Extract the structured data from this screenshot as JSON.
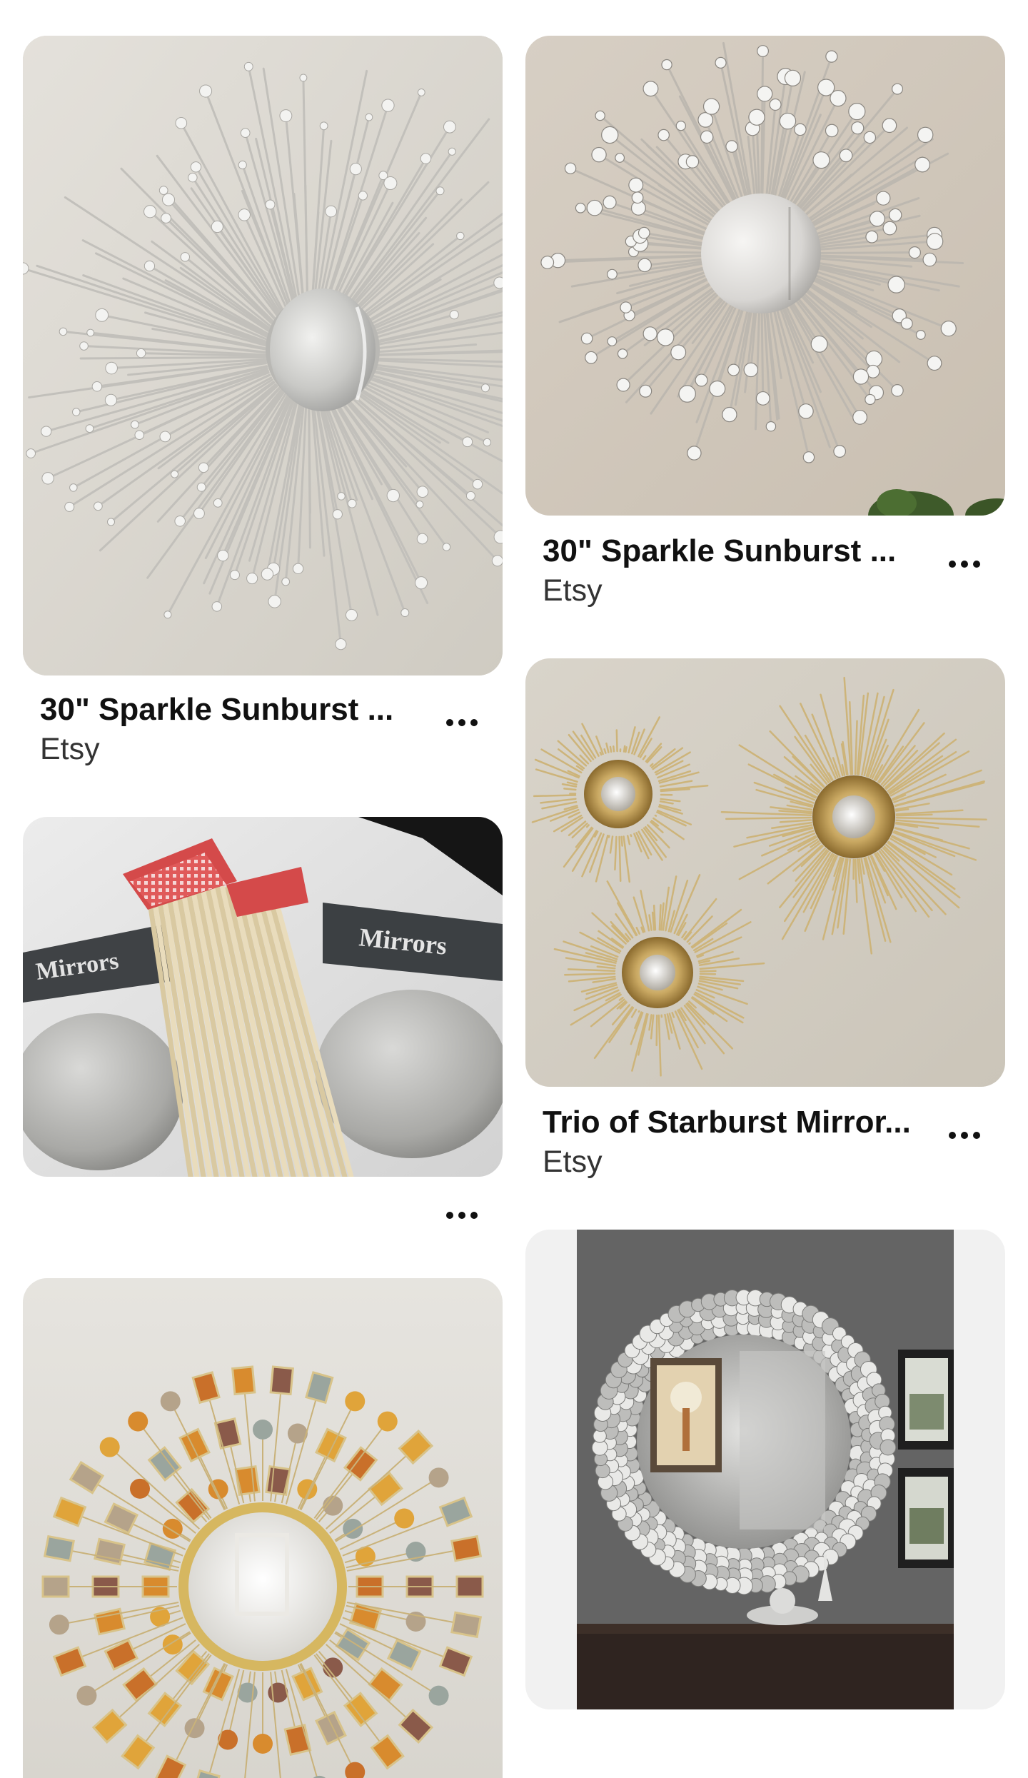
{
  "pins": [
    {
      "id": "pin-1",
      "title": "30\" Sparkle Sunburst ...",
      "source": "Etsy",
      "image_alt": "silver sunburst mirror with sparkle rods"
    },
    {
      "id": "pin-2",
      "title": "30\" Sparkle Sunburst ...",
      "source": "Etsy",
      "image_alt": "silver sunburst mirror with mirror dots"
    },
    {
      "id": "pin-3",
      "title": "Trio of Starburst Mirror...",
      "source": "Etsy",
      "image_alt": "three gold starburst mirrors"
    },
    {
      "id": "pin-4",
      "title": "",
      "source": "",
      "image_alt": "DIY supplies: round mirrors and wooden skewers"
    },
    {
      "id": "pin-5",
      "title": "",
      "source": "",
      "image_alt": "jeweled sunburst mirror with amber and stone tiles"
    },
    {
      "id": "pin-6",
      "title": "",
      "source": "",
      "image_alt": "round crystal mirror above a console table"
    }
  ],
  "supplies_package_label": "Mirrors",
  "icons": {
    "more": "more-horizontal-icon"
  },
  "colors": {
    "text_primary": "#111111",
    "text_secondary": "#333333",
    "background": "#ffffff"
  }
}
